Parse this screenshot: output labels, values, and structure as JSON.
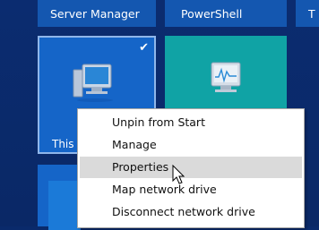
{
  "tiles": {
    "server_manager": "Server Manager",
    "powershell": "PowerShell",
    "edge_tile": "T",
    "this_pc": "This"
  },
  "context_menu": {
    "items": [
      "Unpin from Start",
      "Manage",
      "Properties",
      "Map network drive",
      "Disconnect network drive"
    ],
    "hovered": "Properties"
  },
  "colors": {
    "background": "#0a2a6b",
    "tile_blue": "#1565c8",
    "tile_teal": "#10a3a5",
    "menu_hover": "#dadada"
  },
  "icons": [
    "computer-icon",
    "performance-monitor-icon",
    "checkmark-icon",
    "mouse-cursor-icon"
  ]
}
